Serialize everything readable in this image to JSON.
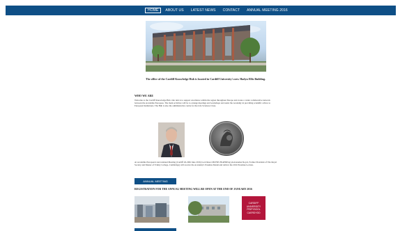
{
  "nav": {
    "items": [
      {
        "label": "HOME",
        "active": true
      },
      {
        "label": "ABOUT US",
        "active": false
      },
      {
        "label": "LATEST NEWS",
        "active": false
      },
      {
        "label": "CONTACT",
        "active": false
      },
      {
        "label": "ANNUAL MEETING 2016",
        "active": false
      }
    ]
  },
  "hero": {
    "caption": "The office of the Cardiff Knowledge Hub is located in Cardiff University's new Hadyn Ellis Building."
  },
  "who": {
    "title": "WHO WE ARE",
    "body": "Welcome to the Cardiff Knowledge Hub. Our aim is to support excellence within the region throughout Europe and create a wider collaborative network between the Academia Europaea. The main activities will be to arrange meetings and workshops and assist the Academy in providing scientific advice to European Institutions. The Hub is also the administrative centre for the Life Sciences Class."
  },
  "meeting": {
    "body": "At Academia Europaea's next Annual Meeting (Cardiff 26-29th June 2016) Lord Rees OM FRS HonFREng (Astronomer Royal, Former President of The Royal Society and Master of Trinity College, Cambridge) will receive the Academy's Erasmus Medal and deliver the 2016 Erasmus Lecture.",
    "button_label": "ANNUAL MEETING",
    "registration": "REGISTRATION FOR THE ANNUAL MEETING WILL BE OPEN AT THE END OF JANUARY 2016"
  },
  "logo": {
    "lines": [
      "CARDIFF",
      "UNIVERSITY",
      "PRIFYSGOL",
      "CAERDYDD"
    ]
  },
  "colors": {
    "nav_bg": "#0e4f86",
    "button_bg": "#0e4f86",
    "logo_bg": "#b3163b"
  }
}
